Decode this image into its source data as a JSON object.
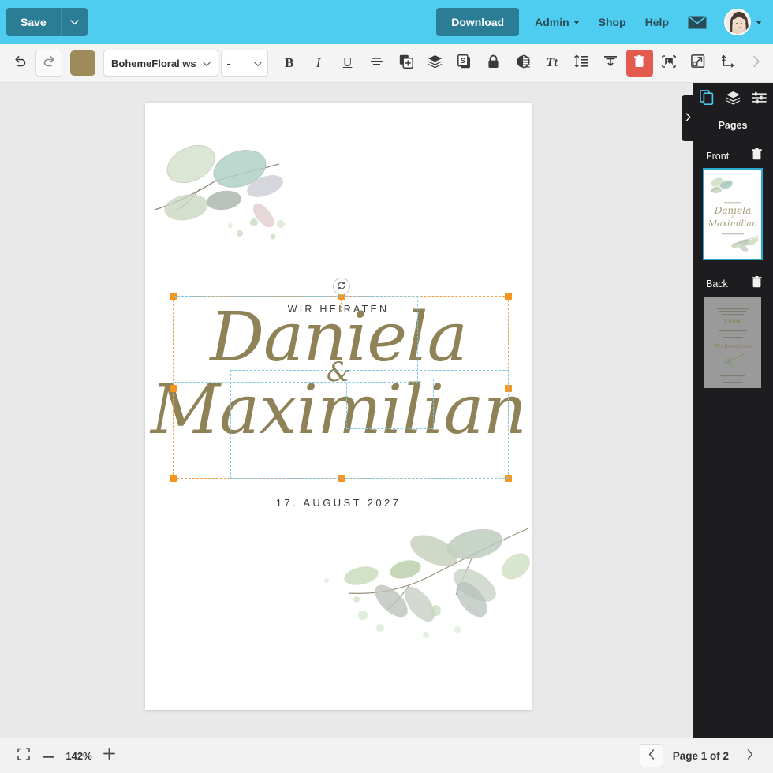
{
  "topbar": {
    "save_label": "Save",
    "save_caret_icon": "chevron-down-icon",
    "download_label": "Download",
    "menu": [
      {
        "label": "Admin",
        "has_caret": true
      },
      {
        "label": "Shop",
        "has_caret": false
      },
      {
        "label": "Help",
        "has_caret": false
      }
    ],
    "mail_icon": "envelope-icon",
    "avatar_icon": "user-avatar",
    "avatar_caret_icon": "chevron-down-icon",
    "bg_color": "#4fcdf0",
    "button_color": "#2b7d96"
  },
  "toolbar": {
    "undo_icon": "undo-icon",
    "redo_icon": "redo-icon",
    "color_swatch": "#9d8c5a",
    "font_name": "BohemeFloral ws",
    "font_caret_icon": "chevron-down-icon",
    "font_size": "-",
    "size_caret_icon": "chevron-down-icon",
    "bold_label": "B",
    "italic_label": "I",
    "underline_label": "U",
    "align_icon": "align-center-icon",
    "duplicate_icon": "duplicate-icon",
    "layers_icon": "layers-icon",
    "shadow_icon": "shadow-icon",
    "lock_icon": "lock-icon",
    "opacity_icon": "opacity-icon",
    "texttransform_label": "Tt",
    "linespacing_icon": "line-spacing-icon",
    "vertical_align_icon": "vertical-align-icon",
    "delete_icon": "trash-icon",
    "delete_color": "#e55a4e",
    "image_icon": "image-placeholder-icon",
    "resize_icon": "resize-icon",
    "position_icon": "position-axes-icon",
    "more_icon": "chevron-right-icon"
  },
  "canvas": {
    "zoom_label": "142%",
    "card": {
      "eyebrow": "WIR HEIRATEN",
      "name_first": "Daniela",
      "ampersand": "&",
      "name_second": "Maximilian",
      "date": "17. AUGUST 2027",
      "text_color": "#8e8256",
      "background": "#ffffff",
      "decoration_top_left": "eucalyptus-branch",
      "decoration_bottom_right": "eucalyptus-branch"
    },
    "selection": {
      "outer_color": "#f0a04b",
      "handle_color": "#f7941e",
      "inner_color": "#7ec8e8",
      "rotate_icon": "rotate-icon"
    }
  },
  "sidebar": {
    "tabs": [
      {
        "name": "pages-tab",
        "icon": "pages-icon",
        "active": true
      },
      {
        "name": "layers-tab",
        "icon": "layers-icon",
        "active": false
      },
      {
        "name": "settings-tab",
        "icon": "sliders-icon",
        "active": false
      }
    ],
    "title": "Pages",
    "pages": [
      {
        "label": "Front",
        "selected": true,
        "delete_icon": "trash-icon"
      },
      {
        "label": "Back",
        "selected": false,
        "delete_icon": "trash-icon"
      }
    ],
    "collapse_icon": "chevron-right-icon",
    "accent_color": "#4fc8f0",
    "bg_color": "#1d1d20"
  },
  "bottombar": {
    "fit_icon": "fit-screen-icon",
    "zoom_out_icon": "minus-icon",
    "zoom_value": "142%",
    "zoom_in_icon": "plus-icon",
    "prev_icon": "chevron-left-icon",
    "page_label": "Page 1 of 2",
    "next_icon": "chevron-right-icon"
  }
}
